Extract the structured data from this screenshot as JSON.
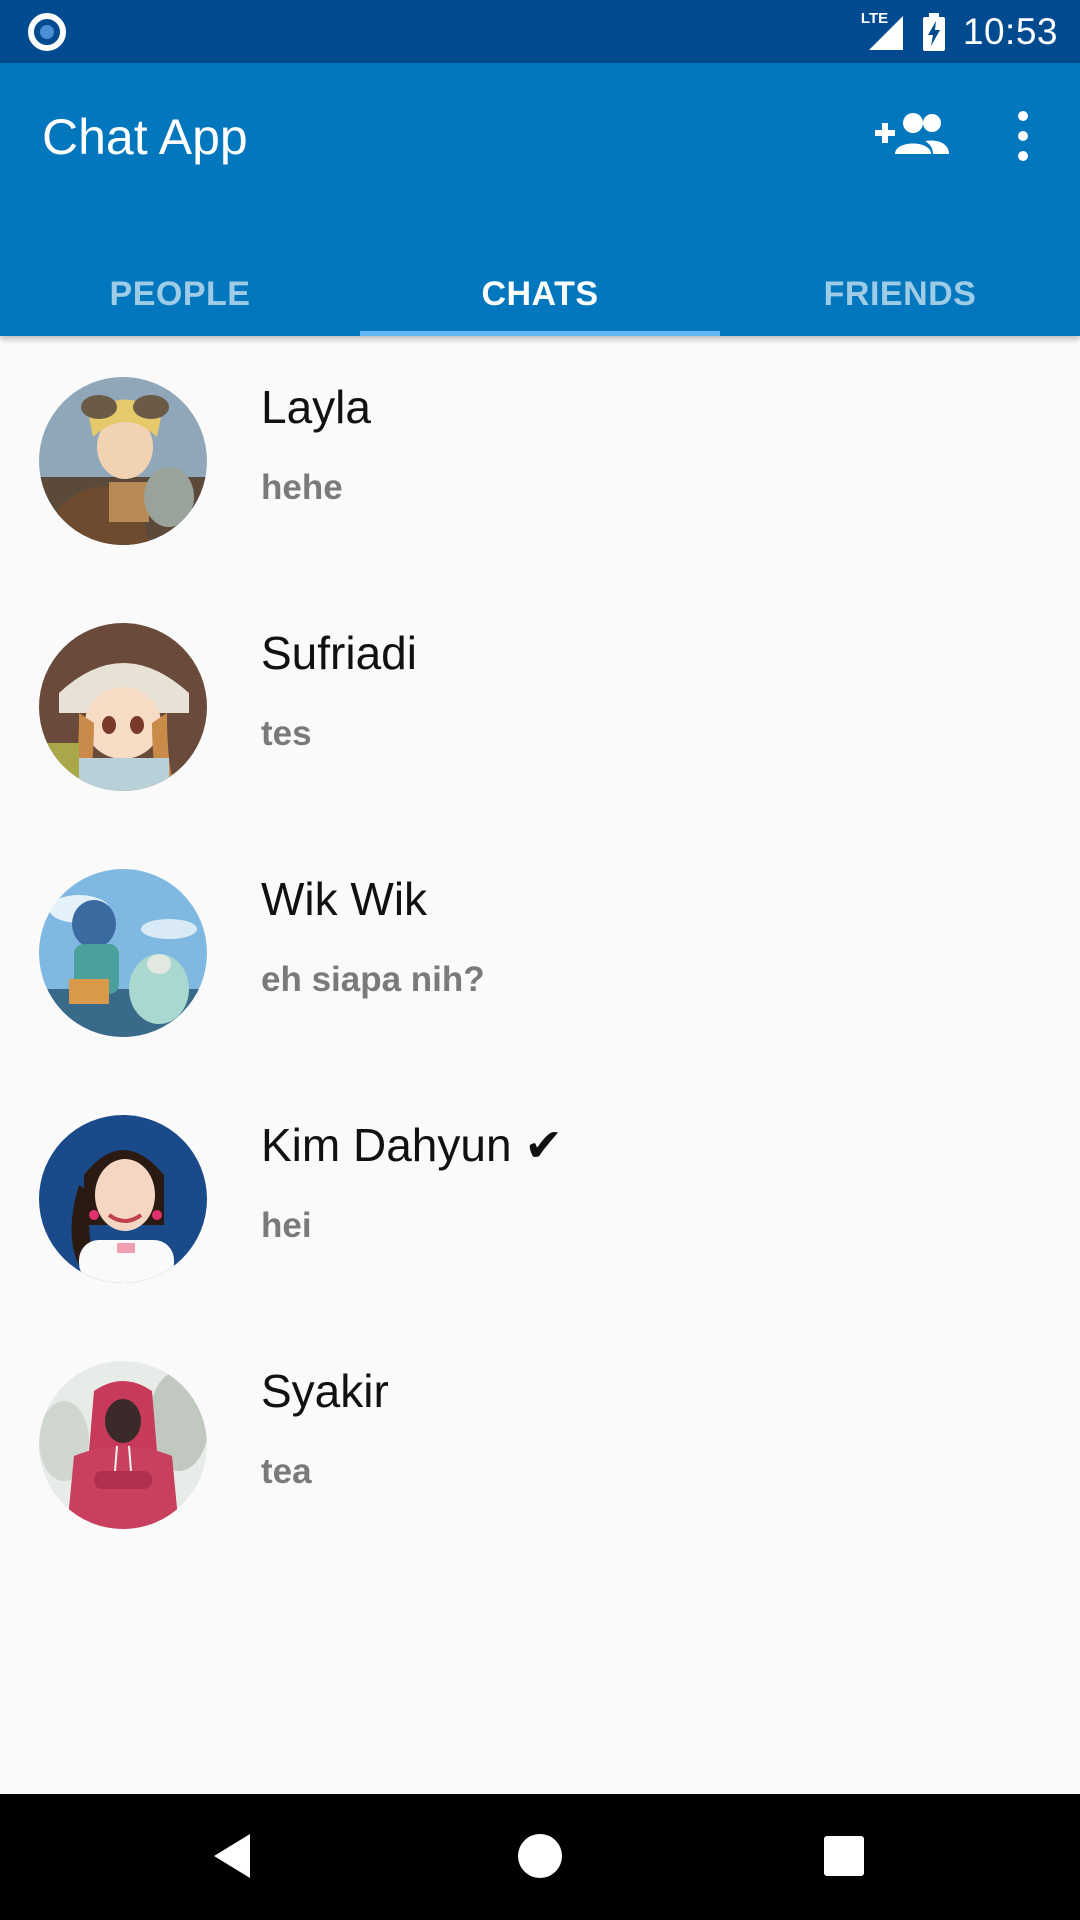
{
  "status_bar": {
    "time": "10:53",
    "network": "LTE",
    "icons": [
      "app-indicator-icon",
      "signal-lte-icon",
      "battery-charging-icon"
    ]
  },
  "app_bar": {
    "title": "Chat App",
    "actions": [
      "add-friend-icon",
      "more-vert-icon"
    ],
    "color": "#0277bd"
  },
  "tabs": [
    {
      "label": "PEOPLE",
      "active": false
    },
    {
      "label": "CHATS",
      "active": true
    },
    {
      "label": "FRIENDS",
      "active": false
    }
  ],
  "chats": [
    {
      "name": "Layla",
      "message": "hehe"
    },
    {
      "name": "Sufriadi",
      "message": "tes"
    },
    {
      "name": "Wik Wik",
      "message": "eh siapa nih?"
    },
    {
      "name": "Kim Dahyun ✔",
      "message": "hei"
    },
    {
      "name": "Syakir",
      "message": "tea"
    }
  ],
  "nav_bar": {
    "buttons": [
      "back-icon",
      "home-icon",
      "recent-apps-icon"
    ]
  },
  "colors": {
    "status_bar": "#004a8f",
    "accent": "#0277bd",
    "tab_indicator": "#64b5f6"
  }
}
